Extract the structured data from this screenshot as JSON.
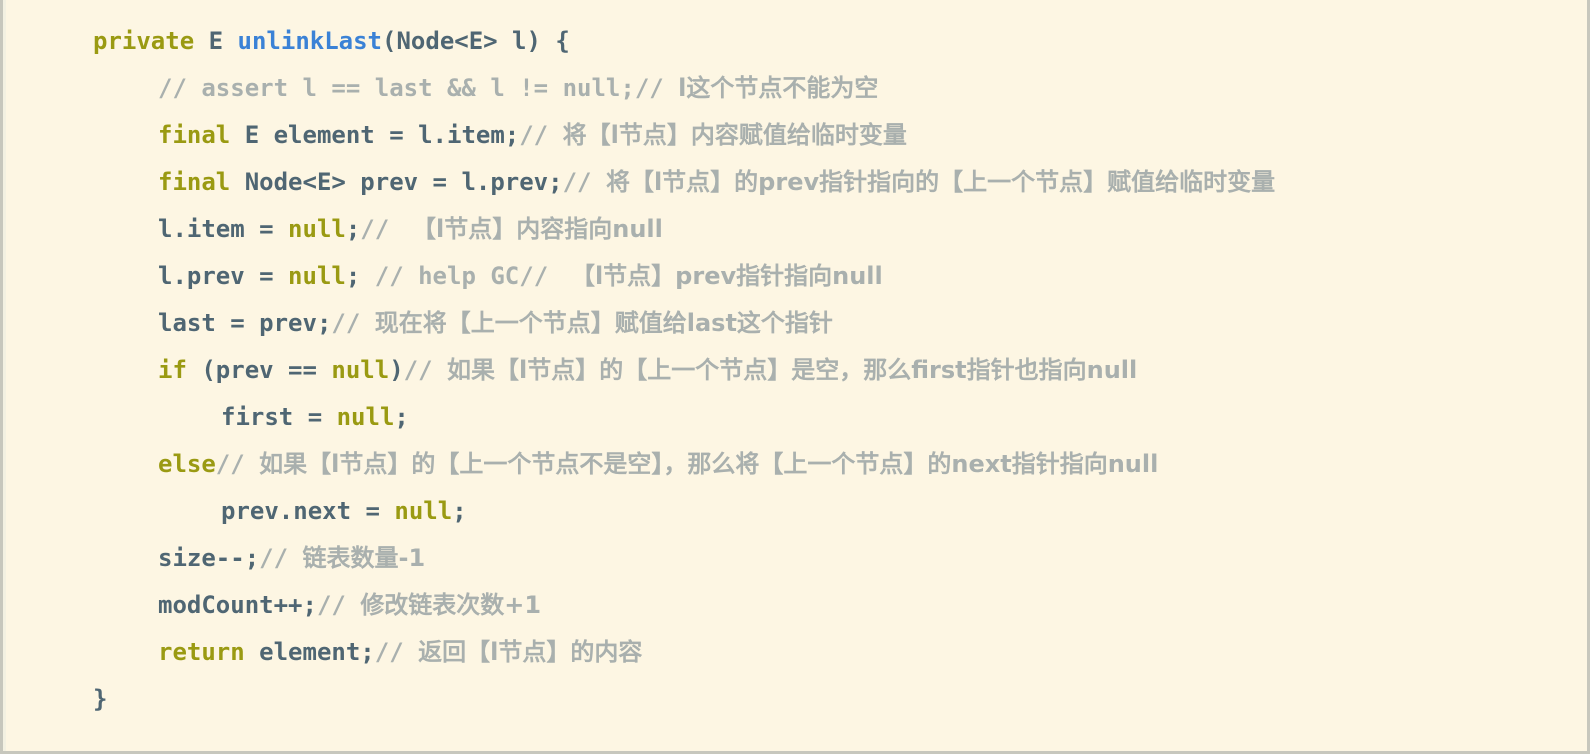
{
  "editor": {
    "language": "java",
    "background_color": "#fdf6e3",
    "border_color": "#c7c7bd",
    "colors": {
      "keyword": "#9a9a12",
      "identifier": "#4f6673",
      "method_name": "#3b82d6",
      "comment": "#a9b0ae",
      "null_literal": "#9a9a12"
    }
  },
  "code": {
    "lines": [
      {
        "indent": 0,
        "tokens": [
          {
            "kind": "keyword",
            "text": "private"
          },
          {
            "kind": "plain",
            "text": " "
          },
          {
            "kind": "type",
            "text": "E"
          },
          {
            "kind": "plain",
            "text": " "
          },
          {
            "kind": "fn",
            "text": "unlinkLast"
          },
          {
            "kind": "plain",
            "text": "(Node<E> l) {"
          }
        ]
      },
      {
        "indent": 1,
        "tokens": [
          {
            "kind": "comment",
            "text": "// assert l == last && l != null;// "
          },
          {
            "kind": "comment-cjk",
            "text": "l这个节点不能为空"
          }
        ]
      },
      {
        "indent": 1,
        "tokens": [
          {
            "kind": "keyword",
            "text": "final"
          },
          {
            "kind": "plain",
            "text": " E element = l.item;"
          },
          {
            "kind": "comment",
            "text": "// "
          },
          {
            "kind": "comment-cjk",
            "text": "将【l节点】内容赋值给临时变量"
          }
        ]
      },
      {
        "indent": 1,
        "tokens": [
          {
            "kind": "keyword",
            "text": "final"
          },
          {
            "kind": "plain",
            "text": " Node<E> prev = l.prev;"
          },
          {
            "kind": "comment",
            "text": "// "
          },
          {
            "kind": "comment-cjk",
            "text": "将【l节点】的prev指针指向的【上一个节点】赋值给临时变量"
          }
        ]
      },
      {
        "indent": 1,
        "tokens": [
          {
            "kind": "plain",
            "text": "l.item = "
          },
          {
            "kind": "null",
            "text": "null"
          },
          {
            "kind": "plain",
            "text": ";"
          },
          {
            "kind": "comment",
            "text": "// "
          },
          {
            "kind": "comment-cjk",
            "text": " 【l节点】内容指向null"
          }
        ]
      },
      {
        "indent": 1,
        "tokens": [
          {
            "kind": "plain",
            "text": "l.prev = "
          },
          {
            "kind": "null",
            "text": "null"
          },
          {
            "kind": "plain",
            "text": "; "
          },
          {
            "kind": "comment",
            "text": "// help GC// "
          },
          {
            "kind": "comment-cjk",
            "text": " 【l节点】prev指针指向null"
          }
        ]
      },
      {
        "indent": 1,
        "tokens": [
          {
            "kind": "plain",
            "text": "last = prev;"
          },
          {
            "kind": "comment",
            "text": "// "
          },
          {
            "kind": "comment-cjk",
            "text": "现在将【上一个节点】赋值给last这个指针"
          }
        ]
      },
      {
        "indent": 1,
        "tokens": [
          {
            "kind": "keyword",
            "text": "if"
          },
          {
            "kind": "plain",
            "text": " (prev == "
          },
          {
            "kind": "null",
            "text": "null"
          },
          {
            "kind": "plain",
            "text": ")"
          },
          {
            "kind": "comment",
            "text": "// "
          },
          {
            "kind": "comment-cjk",
            "text": "如果【l节点】的【上一个节点】是空，那么first指针也指向null"
          }
        ]
      },
      {
        "indent": 2,
        "tokens": [
          {
            "kind": "plain",
            "text": "first = "
          },
          {
            "kind": "null",
            "text": "null"
          },
          {
            "kind": "plain",
            "text": ";"
          }
        ]
      },
      {
        "indent": 1,
        "tokens": [
          {
            "kind": "keyword",
            "text": "else"
          },
          {
            "kind": "comment",
            "text": "// "
          },
          {
            "kind": "comment-cjk",
            "text": "如果【l节点】的【上一个节点不是空】，那么将【上一个节点】的next指针指向null"
          }
        ]
      },
      {
        "indent": 2,
        "tokens": [
          {
            "kind": "plain",
            "text": "prev.next = "
          },
          {
            "kind": "null",
            "text": "null"
          },
          {
            "kind": "plain",
            "text": ";"
          }
        ]
      },
      {
        "indent": 1,
        "tokens": [
          {
            "kind": "plain",
            "text": "size--;"
          },
          {
            "kind": "comment",
            "text": "// "
          },
          {
            "kind": "comment-cjk",
            "text": "链表数量-1"
          }
        ]
      },
      {
        "indent": 1,
        "tokens": [
          {
            "kind": "plain",
            "text": "modCount++;"
          },
          {
            "kind": "comment",
            "text": "// "
          },
          {
            "kind": "comment-cjk",
            "text": "修改链表次数+1"
          }
        ]
      },
      {
        "indent": 1,
        "tokens": [
          {
            "kind": "keyword",
            "text": "return"
          },
          {
            "kind": "plain",
            "text": " element;"
          },
          {
            "kind": "comment",
            "text": "// "
          },
          {
            "kind": "comment-cjk",
            "text": "返回【l节点】的内容"
          }
        ]
      },
      {
        "indent": 0,
        "tokens": [
          {
            "kind": "plain",
            "text": "}"
          }
        ]
      }
    ]
  }
}
